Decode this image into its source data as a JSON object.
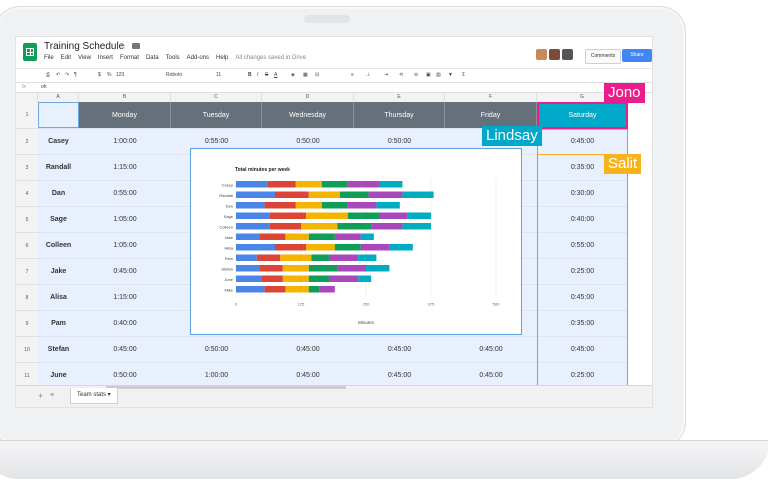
{
  "doc": {
    "title": "Training Schedule",
    "saved_status": "All changes saved in Drive"
  },
  "menu": [
    "File",
    "Edit",
    "View",
    "Insert",
    "Format",
    "Data",
    "Tools",
    "Add-ons",
    "Help"
  ],
  "header": {
    "comments_label": "Comments",
    "share_label": "Share"
  },
  "toolbar": {
    "zoom": "123",
    "font": "Roboto",
    "font_size": "11"
  },
  "formula_bar": {
    "fx": "fx",
    "value": "oh"
  },
  "columns": [
    "A",
    "B",
    "C",
    "D",
    "E",
    "F",
    "G"
  ],
  "days": [
    "Monday",
    "Tuesday",
    "Wednesday",
    "Thursday",
    "Friday",
    "Saturday"
  ],
  "rows": [
    {
      "num": "1"
    },
    {
      "num": "2",
      "name": "Casey",
      "values": [
        "1:00:00",
        "0:55:00",
        "0:50:00",
        "0:50:00",
        "",
        "0:45:00"
      ]
    },
    {
      "num": "3",
      "name": "Randall",
      "values": [
        "1:15:00",
        "",
        "",
        "",
        "",
        "0:35:00"
      ]
    },
    {
      "num": "4",
      "name": "Dan",
      "values": [
        "0:55:00",
        "",
        "",
        "",
        "",
        "0:30:00"
      ]
    },
    {
      "num": "5",
      "name": "Sage",
      "values": [
        "1:05:00",
        "",
        "",
        "",
        "",
        "0:40:00"
      ]
    },
    {
      "num": "6",
      "name": "Colleen",
      "values": [
        "1:05:00",
        "",
        "",
        "",
        "",
        "0:55:00"
      ]
    },
    {
      "num": "7",
      "name": "Jake",
      "values": [
        "0:45:00",
        "",
        "",
        "",
        "",
        "0:25:00"
      ]
    },
    {
      "num": "8",
      "name": "Alisa",
      "values": [
        "1:15:00",
        "",
        "",
        "",
        "",
        "0:45:00"
      ]
    },
    {
      "num": "9",
      "name": "Pam",
      "values": [
        "0:40:00",
        "",
        "",
        "",
        "",
        "0:35:00"
      ]
    },
    {
      "num": "10",
      "name": "Stefan",
      "values": [
        "0:45:00",
        "0:50:00",
        "0:45:00",
        "0:45:00",
        "0:45:00",
        "0:45:00"
      ]
    },
    {
      "num": "11",
      "name": "June",
      "values": [
        "0:50:00",
        "1:00:00",
        "0:45:00",
        "0:45:00",
        "0:45:00",
        "0:25:00"
      ]
    }
  ],
  "sheet_tab": "Team stats",
  "collaborators": [
    {
      "name": "Jono",
      "color": "#e91e8c"
    },
    {
      "name": "Lindsay",
      "color": "#00a9c9"
    },
    {
      "name": "Salit",
      "color": "#f9b31a"
    }
  ],
  "chart_data": {
    "type": "bar",
    "orientation": "horizontal",
    "stacked": true,
    "title": "Total minutes per week",
    "xlabel": "Minutes",
    "ylabel": "",
    "xlim": [
      0,
      500
    ],
    "xticks": [
      "0",
      "125",
      "250",
      "375",
      "500"
    ],
    "grid": true,
    "categories": [
      "Casey",
      "Randall",
      "Dan",
      "Sage",
      "Colleen",
      "Jake",
      "Alisa",
      "Pam",
      "Stefan",
      "June",
      "Mike"
    ],
    "series": [
      {
        "color": "#4a86e8",
        "values": [
          60,
          75,
          55,
          65,
          65,
          45,
          75,
          40,
          45,
          50,
          55
        ]
      },
      {
        "color": "#db4437",
        "values": [
          55,
          65,
          60,
          70,
          60,
          50,
          60,
          45,
          45,
          40,
          40
        ]
      },
      {
        "color": "#f4b400",
        "values": [
          50,
          60,
          50,
          80,
          70,
          45,
          55,
          60,
          50,
          50,
          45
        ]
      },
      {
        "color": "#0f9d58",
        "values": [
          50,
          55,
          50,
          60,
          65,
          50,
          50,
          35,
          55,
          40,
          20
        ]
      },
      {
        "color": "#ab47bc",
        "values": [
          60,
          65,
          55,
          55,
          60,
          50,
          55,
          55,
          55,
          55,
          30
        ]
      },
      {
        "color": "#00acc1",
        "values": [
          45,
          60,
          45,
          45,
          55,
          25,
          45,
          35,
          45,
          25,
          0
        ]
      }
    ]
  }
}
